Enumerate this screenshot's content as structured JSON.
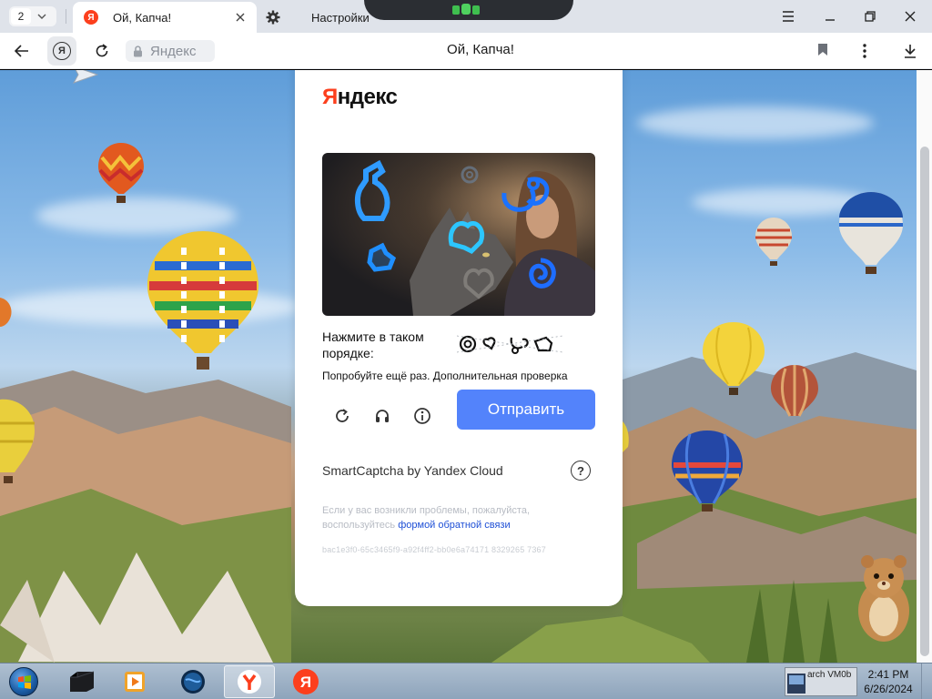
{
  "browser": {
    "tab_count": "2",
    "tabs": [
      {
        "title": "Ой, Капча!",
        "favicon": "yandex-favicon",
        "active": true
      },
      {
        "title": "Настройки",
        "favicon": "gear-icon",
        "active": false
      }
    ],
    "yandex_button_letter": "Я",
    "site_chip": "Яндекс",
    "page_title": "Ой, Капча!"
  },
  "captcha": {
    "logo_first": "Я",
    "logo_rest": "ндекс",
    "instruction": "Нажмите в таком порядке:",
    "retry_message": "Попробуйте ещё раз. Дополнительная проверка",
    "submit_label": "Отправить",
    "brand": "SmartCaptcha by Yandex Cloud",
    "help_glyph": "?",
    "issues_text": "Если у вас возникли проблемы, пожалуйста, воспользуйтесь ",
    "issues_link": "формой обратной связи",
    "request_id": "bac1e3f0-65c3465f9-a92f4ff2-bb0e6a74171 8329265 7367",
    "order_icon_names": [
      "spiral-icon",
      "heart-icon",
      "stethoscope-icon",
      "bottle-icon"
    ]
  },
  "taskbar": {
    "apps": [
      "terminal-app",
      "media-player-app",
      "globe-app",
      "yandex-browser-app",
      "yandex-app"
    ],
    "yandex_glyph": "Я",
    "tray_thumb_text": "arch VM0b",
    "time": "2:41 PM",
    "date": "6/26/2024"
  },
  "colors": {
    "accent": "#5383fb",
    "brand_red": "#fc3f1d",
    "link": "#1e4fd6"
  }
}
